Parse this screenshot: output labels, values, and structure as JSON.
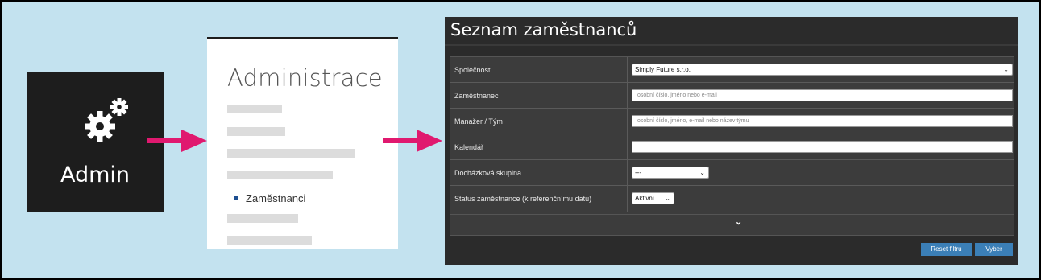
{
  "admin_tile": {
    "label": "Admin",
    "icon": "gears-icon"
  },
  "admin_panel": {
    "title": "Administrace",
    "highlighted_item": "Zaměstnanci"
  },
  "employees": {
    "title": "Seznam zaměstnanců",
    "fields": [
      {
        "label": "Společnost",
        "value": "Simply Future s.r.o."
      },
      {
        "label": "Zaměstnanec",
        "placeholder": "osobní číslo, jméno nebo e-mail"
      },
      {
        "label": "Manažer / Tým",
        "placeholder": "osobní číslo, jméno, e-mail nebo název týmu"
      },
      {
        "label": "Kalendář",
        "value": ""
      },
      {
        "label": "Docházková skupina",
        "value": "---"
      },
      {
        "label": "Status zaměstnance (k referenčnímu datu)",
        "value": "Aktivní"
      }
    ],
    "expand_icon": "chevron-down-icon",
    "reset_label": "Reset filtru",
    "select_label": "Vyber"
  },
  "colors": {
    "background": "#c3e2ef",
    "arrow": "#e0196f",
    "button": "#3b7fb7"
  }
}
